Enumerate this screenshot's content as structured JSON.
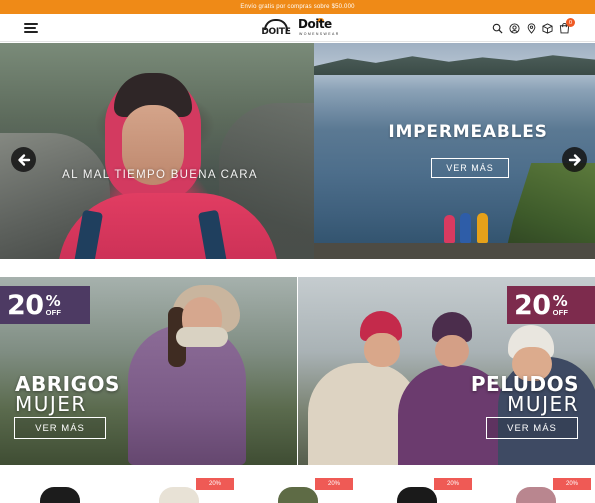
{
  "promo_bar": {
    "text": "Envío gratis por compras sobre $50.000"
  },
  "header": {
    "logo_main": "DOITE",
    "logo_woman": "Doite",
    "logo_woman_sub": "WOMENSWEAR",
    "cart_count": "0",
    "icons": [
      "menu-icon",
      "search-icon",
      "user-icon",
      "location-icon",
      "box-icon",
      "cart-icon"
    ]
  },
  "hero": {
    "left_tagline": "AL MAL TIEMPO BUENA CARA",
    "right_headline": "IMPERMEABLES",
    "right_cta": "VER MÁS"
  },
  "promos": [
    {
      "discount": "20",
      "percent": "%",
      "off": "OFF",
      "title": "ABRIGOS",
      "subtitle": "MUJER",
      "cta": "VER MÁS"
    },
    {
      "discount": "20",
      "percent": "%",
      "off": "OFF",
      "title": "PELUDOS",
      "subtitle": "MUJER",
      "cta": "VER MÁS"
    }
  ],
  "products": [
    {
      "badge": "",
      "color": "#1c1c1c"
    },
    {
      "badge": "20%",
      "color": "#e8e2d6"
    },
    {
      "badge": "20%",
      "color": "#5e6b45"
    },
    {
      "badge": "20%",
      "color": "#1a1a1a"
    },
    {
      "badge": "20%",
      "color": "#b9868f"
    }
  ],
  "colors": {
    "accent": "#ef8a17",
    "badge_red": "#ef5a55",
    "promo_purple": "#4d3a63",
    "promo_wine": "#7d2b4d"
  }
}
